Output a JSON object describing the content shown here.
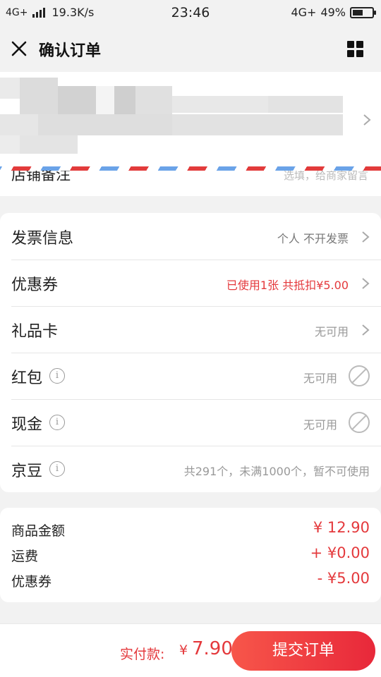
{
  "status_bar": {
    "network_left": "4G+",
    "speed": "19.3K/s",
    "time": "23:46",
    "network_right": "4G+",
    "battery": "49%"
  },
  "nav": {
    "title": "确认订单",
    "close_icon": "close-icon",
    "menu_icon": "grid-icon"
  },
  "address": {
    "note_label": "店铺备注",
    "note_hint": "选填，给商家留言"
  },
  "settings": [
    {
      "label": "发票信息",
      "value": "个人 不开发票",
      "value_style": "normal",
      "trailing": "chevron"
    },
    {
      "label": "优惠券",
      "value": "已使用1张 共抵扣¥5.00",
      "value_style": "red",
      "trailing": "chevron"
    },
    {
      "label": "礼品卡",
      "value": "无可用",
      "value_style": "muted",
      "trailing": "chevron"
    },
    {
      "label": "红包",
      "value": "无可用",
      "value_style": "muted",
      "trailing": "disabled",
      "info": "i"
    },
    {
      "label": "现金",
      "value": "无可用",
      "value_style": "muted",
      "trailing": "disabled",
      "info": "i"
    },
    {
      "label": "京豆",
      "value": "共291个，未满1000个，暂不可使用",
      "value_style": "muted",
      "trailing": "none",
      "info": "i"
    }
  ],
  "amounts": [
    {
      "label": "商品金额",
      "value": "¥ 12.90"
    },
    {
      "label": "运费",
      "value": "+ ¥0.00"
    },
    {
      "label": "优惠券",
      "value": "- ¥5.00"
    }
  ],
  "footer": {
    "pay_label": "实付款:",
    "currency": "¥",
    "pay_amount": "7.90",
    "submit_label": "提交订单"
  },
  "colors": {
    "accent_red": "#e4393c",
    "button_gradient_start": "#f7564a",
    "button_gradient_end": "#e8283a"
  }
}
